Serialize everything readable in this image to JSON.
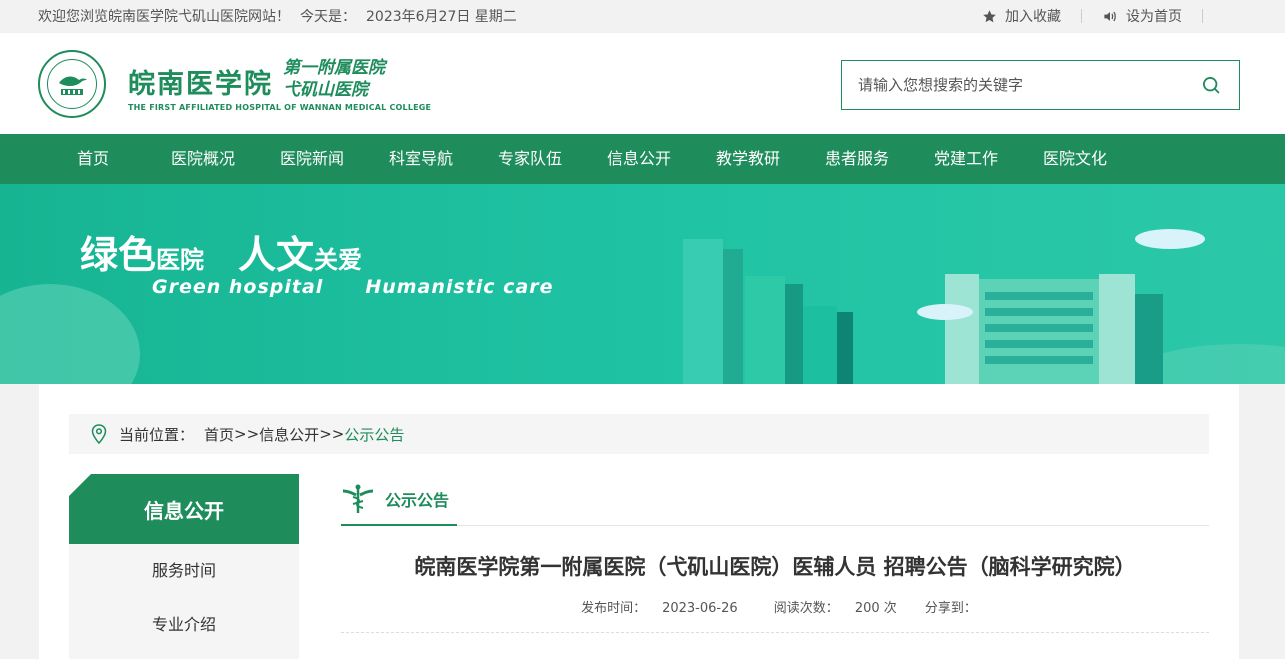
{
  "topbar": {
    "welcome": "欢迎您浏览皖南医学院弋矶山医院网站！",
    "date_prefix": "今天是：",
    "date": "2023年6月27日 星期二",
    "favorite": "加入收藏",
    "homepage": "设为首页"
  },
  "header": {
    "logo_cn": "皖南医学院",
    "logo_cn_sub1": "第一附属医院",
    "logo_cn_sub2": "弋矶山医院",
    "logo_en": "THE FIRST AFFILIATED HOSPITAL OF WANNAN MEDICAL COLLEGE",
    "search_placeholder": "请输入您想搜索的关键字"
  },
  "nav": {
    "items": [
      "首页",
      "医院概况",
      "医院新闻",
      "科室导航",
      "专家队伍",
      "信息公开",
      "教学教研",
      "患者服务",
      "党建工作",
      "医院文化"
    ]
  },
  "banner": {
    "title_1": "绿色",
    "title_2": "医院",
    "title_3": "人文",
    "title_4": "关爱",
    "sub_1": "Green hospital",
    "sub_2": "Humanistic care"
  },
  "breadcrumb": {
    "label": "当前位置：",
    "home": "首页",
    "sep": ">>",
    "level2": "信息公开",
    "current": "公示公告"
  },
  "sidebar": {
    "title": "信息公开",
    "items": [
      "服务时间",
      "专业介绍"
    ]
  },
  "main": {
    "tab": "公示公告",
    "article_title": "皖南医学院第一附属医院（弋矶山医院）医辅人员 招聘公告（脑科学研究院）",
    "publish_label": "发布时间：",
    "publish_date": "2023-06-26",
    "views_label": "阅读次数：",
    "views": "200 次",
    "share_label": "分享到："
  },
  "colors": {
    "brand_green": "#1e8c5b",
    "banner_teal": "#1fc3a4"
  }
}
